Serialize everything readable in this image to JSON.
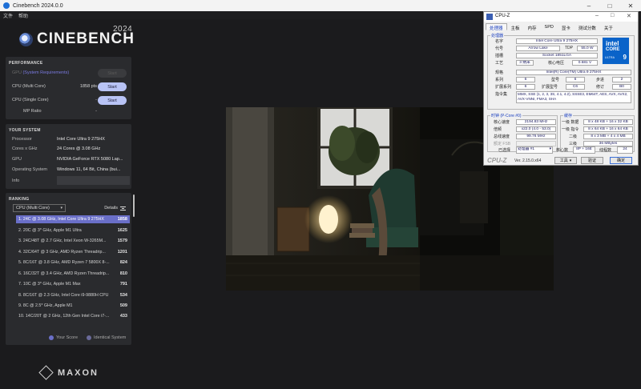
{
  "window": {
    "title": "Cinebench 2024.0.0",
    "controls": [
      "–",
      "□",
      "✕"
    ]
  },
  "menu": [
    "文件",
    "帮助"
  ],
  "logo": {
    "text": "CINEBENCH",
    "year": "2024"
  },
  "performance": {
    "heading": "PERFORMANCE",
    "gpu_label_prefix": "GPU",
    "gpu_label_note": "(System Requirements)",
    "gpu_btn": "Start",
    "multi_label": "CPU (Multi Core)",
    "multi_value": "1858 pts",
    "multi_btn": "Start",
    "single_label": "CPU (Single Core)",
    "single_value": "-",
    "single_btn": "Start",
    "mp_label": "MP Ratio",
    "mp_value": "-"
  },
  "system": {
    "heading": "YOUR SYSTEM",
    "rows": [
      {
        "k": "Processor",
        "v": "Intel Core Ultra 9 275HX"
      },
      {
        "k": "Cores x GHz",
        "v": "24 Cores @ 3.08 GHz"
      },
      {
        "k": "GPU",
        "v": "NVIDIA GeForce RTX 5080 Lap..."
      },
      {
        "k": "Operating System",
        "v": "Windows 11, 64 Bit, China (bui..."
      },
      {
        "k": "Info",
        "v": ""
      }
    ]
  },
  "ranking": {
    "heading": "RANKING",
    "select": "CPU (Multi Core)",
    "details": "Details",
    "rows": [
      {
        "n": "1. 24C @ 3.08 GHz, Intel Core Ultra 9 275HX",
        "s": "1858"
      },
      {
        "n": "2. 20C @ 3* GHz, Apple M1 Ultra",
        "s": "1625"
      },
      {
        "n": "3. 24C/48T @ 2.7 GHz, Intel Xeon W-3265M...",
        "s": "1579"
      },
      {
        "n": "4. 32C/64T @ 3 GHz, AMD Ryzen Threadrip...",
        "s": "1201"
      },
      {
        "n": "5. 8C/16T @ 3.8 GHz, AMD Ryzen 7 5800X 8-...",
        "s": "824"
      },
      {
        "n": "6. 16C/32T @ 3.4 GHz, AMD Ryzen Threadrip...",
        "s": "810"
      },
      {
        "n": "7. 10C @ 3* GHz, Apple M1 Max",
        "s": "791"
      },
      {
        "n": "8. 8C/16T @ 2.3 GHz, Intel Core i9-9880H CPU",
        "s": "534"
      },
      {
        "n": "9. 8C @ 2.5* GHz, Apple M1",
        "s": "509"
      },
      {
        "n": "10. 14C/20T @ 2 GHz, 12th Gen Intel Core i7-...",
        "s": "433"
      }
    ],
    "legend_your": "Your Score",
    "legend_identical": "Identical System"
  },
  "footer": {
    "brand": "MAXON"
  },
  "cpuz": {
    "title": "CPU-Z",
    "tabs": [
      "处理器",
      "主板",
      "内存",
      "SPD",
      "显卡",
      "测试分数",
      "关于"
    ],
    "processor_group": "处理器",
    "name_l": "名字",
    "name_v": "Intel Core Ultra 9 275HX",
    "code_l": "代号",
    "code_v": "Arrow Lake",
    "tdp_l": "TDP",
    "tdp_v": "55.0 W",
    "socket_l": "插槽",
    "socket_v": "Socket 1851LGA",
    "tech_l": "工艺",
    "tech_v": "3 纳米",
    "volt_l": "核心电压",
    "volt_v": "0.681 V",
    "spec_l": "规格",
    "spec_v": "Intel(R) Core(TM) Ultra 9 275HX",
    "fam_l": "系列",
    "fam_v": "6",
    "model_l": "型号",
    "model_v": "6",
    "step_l": "步进",
    "step_v": "2",
    "xfam_l": "扩展系列",
    "xfam_v": "6",
    "xmodel_l": "扩展型号",
    "xmodel_v": "C6",
    "rev_l": "修订",
    "rev_v": "B0",
    "inst_l": "指令集",
    "inst_v": "MMX, SSE (1, 2, 3, 3S, 4.1, 4.2), SSSE3, EM64T, AES, AVX, AVX2, AVX-VNNI, FMA3, SHA",
    "clock_group": "时钟 (P-Core #0)",
    "core_speed_l": "核心速度",
    "core_speed_v": "2194.83 MHz",
    "mult_l": "倍频",
    "mult_v": "x22.0 (4.0 - 53.0)",
    "bus_l": "总线速度",
    "bus_v": "99.76 MHz",
    "fsb_l": "额定 FSB",
    "fsb_v": "",
    "cache_group": "缓存",
    "l1d_l": "一级 数据",
    "l1d_v": "8 x 48 KB + 16 x 32 KB",
    "l1i_l": "一级 指令",
    "l1i_v": "8 x 64 KB + 16 x 64 KB",
    "l2_l": "二级",
    "l2_v": "8 x 3 MB + 4 x 4 MB",
    "l3_l": "三级",
    "l3_v": "36 MBytes",
    "sel_l": "已选择",
    "sel_v": "处理器 #1",
    "cores_l": "核心数",
    "cores_v": "8P + 16E",
    "threads_l": "线程数",
    "threads_v": "24",
    "brand": "CPU-Z",
    "ver": "Ver. 2.15.0.x64",
    "tools_btn": "工具",
    "validate_btn": "验证",
    "ok_btn": "确定",
    "intel_a": "intel",
    "intel_b": "CORE",
    "intel_c": "ULTRA",
    "intel_d": "9"
  }
}
